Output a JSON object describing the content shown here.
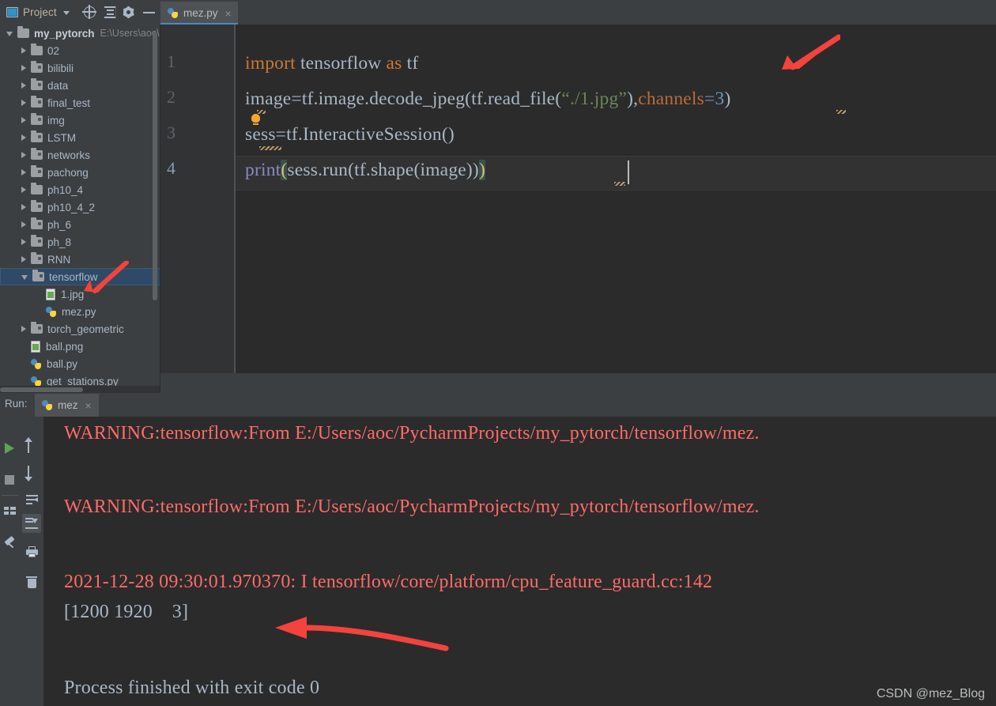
{
  "toolbar": {
    "project_label": "Project",
    "icons": [
      "project-panel-icon",
      "chevron-down-icon",
      "locate-target-icon",
      "collapse-all-icon",
      "gear-icon",
      "minimize-icon"
    ]
  },
  "editor_tabs": [
    {
      "label": "mez.py",
      "close": "×",
      "active": true,
      "icon": "python-file-icon"
    }
  ],
  "sidebar": {
    "scrollbar": "vertical-scrollbar",
    "items": [
      {
        "label": "my_pytorch",
        "path": "E:\\Users\\aoc\\Pyc",
        "indent": 0,
        "state": "open",
        "kind": "folder",
        "bold": true,
        "module": false
      },
      {
        "label": "02",
        "indent": 1,
        "state": "closed",
        "kind": "folder",
        "module": false
      },
      {
        "label": "bilibili",
        "indent": 1,
        "state": "closed",
        "kind": "folder",
        "module": true
      },
      {
        "label": "data",
        "indent": 1,
        "state": "closed",
        "kind": "folder",
        "module": true
      },
      {
        "label": "final_test",
        "indent": 1,
        "state": "closed",
        "kind": "folder",
        "module": true
      },
      {
        "label": "img",
        "indent": 1,
        "state": "closed",
        "kind": "folder",
        "module": true
      },
      {
        "label": "LSTM",
        "indent": 1,
        "state": "closed",
        "kind": "folder",
        "module": true
      },
      {
        "label": "networks",
        "indent": 1,
        "state": "closed",
        "kind": "folder",
        "module": true
      },
      {
        "label": "pachong",
        "indent": 1,
        "state": "closed",
        "kind": "folder",
        "module": true
      },
      {
        "label": "ph10_4",
        "indent": 1,
        "state": "closed",
        "kind": "folder",
        "module": false
      },
      {
        "label": "ph10_4_2",
        "indent": 1,
        "state": "closed",
        "kind": "folder",
        "module": true
      },
      {
        "label": "ph_6",
        "indent": 1,
        "state": "closed",
        "kind": "folder",
        "module": true
      },
      {
        "label": "ph_8",
        "indent": 1,
        "state": "closed",
        "kind": "folder",
        "module": true
      },
      {
        "label": "RNN",
        "indent": 1,
        "state": "closed",
        "kind": "folder",
        "module": true
      },
      {
        "label": "tensorflow",
        "indent": 1,
        "state": "open",
        "kind": "folder",
        "module": true,
        "selected": true
      },
      {
        "label": "1.jpg",
        "indent": 2,
        "state": "leaf",
        "kind": "image"
      },
      {
        "label": "mez.py",
        "indent": 2,
        "state": "leaf",
        "kind": "python"
      },
      {
        "label": "torch_geometric",
        "indent": 1,
        "state": "closed",
        "kind": "folder",
        "module": true
      },
      {
        "label": "ball.png",
        "indent": 1,
        "state": "leaf",
        "kind": "image"
      },
      {
        "label": "ball.py",
        "indent": 1,
        "state": "leaf",
        "kind": "python"
      },
      {
        "label": "get_stations.py",
        "indent": 1,
        "state": "leaf",
        "kind": "python"
      }
    ]
  },
  "code": {
    "lines": [
      {
        "num": "1",
        "text": "import tensorflow as tf"
      },
      {
        "num": "2",
        "text": "image=tf.image.decode_jpeg(tf.read_file(“./1.jpg”),channels=3)"
      },
      {
        "num": "3",
        "text": "sess=tf.InteractiveSession()"
      },
      {
        "num": "4",
        "text": "print(sess.run(tf.shape(image)))"
      }
    ],
    "tokens": {
      "kw_import": "import",
      "kw_as": "as",
      "mod_tensorflow": " tensorflow ",
      "alias_tf": " tf",
      "l2_a": "image=tf.image.decode_jpeg(tf.read_file(",
      "l2_str": "“./1.jpg”",
      "l2_b": "),",
      "l2_named": "channels",
      "l2_eq": "=",
      "l2_num": "3",
      "l2_c": ")",
      "l3": "sess=tf.InteractiveSession()",
      "l4_print": "print",
      "l4_open": "(",
      "l4_mid": "sess.run(tf.shape(image))",
      "l4_close": ")"
    },
    "caret_line": "4",
    "inspection_bulb": "intention-bulb-icon"
  },
  "run_panel": {
    "label": "Run:",
    "tab": {
      "label": "mez",
      "close": "×",
      "icon": "python-file-icon"
    },
    "left_buttons": [
      "rerun-icon",
      "stop-icon",
      "layout-columns-icon",
      "pin-tab-icon"
    ],
    "tool_buttons": [
      "up-arrow-icon",
      "down-arrow-icon",
      "soft-wrap-icon",
      "scroll-to-end-icon",
      "print-icon",
      "trash-icon"
    ],
    "console_lines": [
      {
        "kind": "warn",
        "text": "WARNING:tensorflow:From E:/Users/aoc/PycharmProjects/my_pytorch/tensorflow/mez."
      },
      {
        "kind": "warn",
        "text": "WARNING:tensorflow:From E:/Users/aoc/PycharmProjects/my_pytorch/tensorflow/mez."
      },
      {
        "kind": "warn",
        "text": "2021-12-28 09:30:01.970370: I tensorflow/core/platform/cpu_feature_guard.cc:142"
      },
      {
        "kind": "out",
        "text": "[1200 1920    3]"
      },
      {
        "kind": "out",
        "text": "Process finished with exit code 0"
      }
    ]
  },
  "annotations": [
    {
      "name": "arrow-to-channels",
      "target": "channels=3 argument"
    },
    {
      "name": "arrow-to-tensorflow-folder",
      "target": "tensorflow tree node"
    },
    {
      "name": "arrow-to-shape-output",
      "target": "[1200 1920    3]"
    }
  ],
  "watermark": "CSDN @mez_Blog",
  "colors": {
    "bg_panel": "#3c3f41",
    "bg_editor": "#2b2b2b",
    "gutter": "#313335",
    "text": "#a9b7c6",
    "keyword": "#cc7832",
    "string": "#6a8759",
    "number": "#6897bb",
    "function": "#8888c6",
    "named_arg": "#ba6b38",
    "warn": "#ff6b68",
    "tab_underline": "#4a88c7",
    "selection": "#2f4a66",
    "annotation": "#f4433c"
  }
}
